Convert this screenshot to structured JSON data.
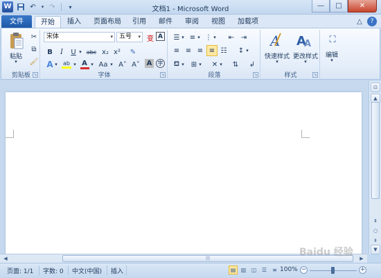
{
  "title": "文档1 - Microsoft Word",
  "title_bar": {
    "logo": "W",
    "save_icon": "💾",
    "undo_icon": "↶",
    "redo_icon": "↷",
    "customize_icon": "▾",
    "minimize_icon": "—",
    "maximize_icon": "□",
    "close_icon": "✕"
  },
  "tabs": {
    "file": "文件",
    "items": [
      "开始",
      "插入",
      "页面布局",
      "引用",
      "邮件",
      "审阅",
      "视图",
      "加载项"
    ],
    "active": "开始",
    "ribbon_toggle_icon": "△",
    "help_icon": "?"
  },
  "ribbon": {
    "clipboard": {
      "paste": "粘贴",
      "group": "剪贴板"
    },
    "font": {
      "font_name": "宋体",
      "font_size": "五号",
      "bold": "B",
      "italic": "I",
      "underline": "U",
      "strike": "abc",
      "subscript": "x₂",
      "superscript": "x²",
      "change_case": "Aa",
      "grow": "A˄",
      "shrink": "A˅",
      "font_color": "A",
      "highlight": "ab",
      "group": "字体"
    },
    "paragraph": {
      "group": "段落"
    },
    "styles": {
      "quick_styles": "快速样式",
      "change_styles": "更改样式",
      "group": "样式"
    },
    "editing": {
      "label": "编辑"
    }
  },
  "status_bar": {
    "page": "页面: 1/1",
    "words": "字数: 0",
    "language": "中文(中国)",
    "insert_mode": "插入",
    "zoom": "100%",
    "zoom_out": "−",
    "zoom_in": "+"
  },
  "watermark": "Baidu 经验",
  "colors": {
    "file_tab": "#1c57a6",
    "ribbon_bg": "#e5eefa",
    "active_align": "#fde9a2",
    "font_color_red": "#d92c2c",
    "highlight_yellow": "#ffff00"
  }
}
